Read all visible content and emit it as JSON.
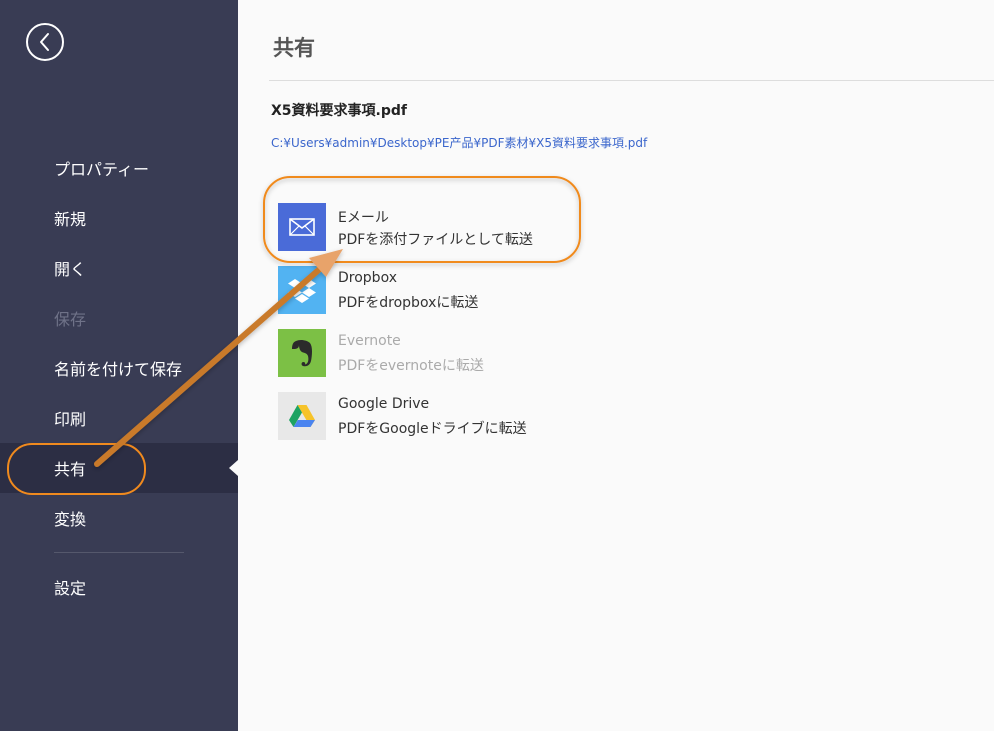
{
  "sidebar": {
    "back_icon": "chevron-left-icon",
    "items": [
      {
        "label": "プロパティー",
        "state": "normal"
      },
      {
        "label": "新規",
        "state": "normal"
      },
      {
        "label": "開く",
        "state": "normal"
      },
      {
        "label": "保存",
        "state": "disabled"
      },
      {
        "label": "名前を付けて保存",
        "state": "normal"
      },
      {
        "label": "印刷",
        "state": "normal"
      },
      {
        "label": "共有",
        "state": "active"
      },
      {
        "label": "変換",
        "state": "normal"
      },
      {
        "label": "設定",
        "state": "normal"
      }
    ]
  },
  "main": {
    "title": "共有",
    "file_name": "X5資料要求事項.pdf",
    "file_path": "C:¥Users¥admin¥Desktop¥PE产品¥PDF素材¥X5資料要求事項.pdf",
    "share_options": [
      {
        "name": "Eメール",
        "description": "PDFを添付ファイルとして転送",
        "icon": "mail-icon",
        "color": "#4a6bd8",
        "state": "highlighted"
      },
      {
        "name": "Dropbox",
        "description": "PDFをdropboxに転送",
        "icon": "dropbox-icon",
        "color": "#52b3f2",
        "state": "normal"
      },
      {
        "name": "Evernote",
        "description": "PDFをevernoteに転送",
        "icon": "evernote-icon",
        "color": "#7cc045",
        "state": "disabled"
      },
      {
        "name": "Google Drive",
        "description": "PDFをGoogleドライブに転送",
        "icon": "google-drive-icon",
        "color": "#e8e8e8",
        "state": "normal"
      }
    ]
  },
  "annotation": {
    "highlight_color": "#f08a1e",
    "arrow_color": "#c97a2c"
  }
}
